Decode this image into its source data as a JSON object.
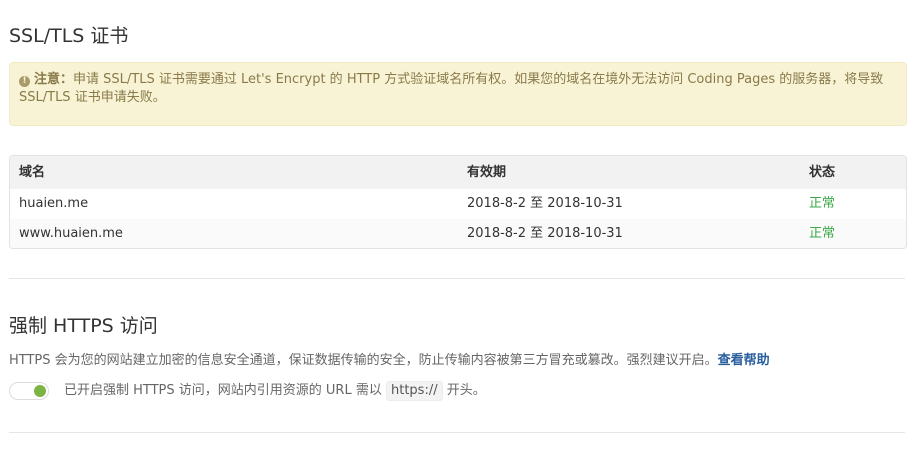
{
  "ssl": {
    "title": "SSL/TLS 证书",
    "warning": {
      "icon": "exclamation-circle-icon",
      "label": "注意：",
      "text": "申请 SSL/TLS 证书需要通过 Let's Encrypt 的 HTTP 方式验证域名所有权。如果您的域名在境外无法访问 Coding Pages 的服务器，将导致 SSL/TLS 证书申请失败。"
    },
    "table": {
      "headers": [
        "域名",
        "有效期",
        "状态"
      ],
      "rows": [
        {
          "domain": "huaien.me",
          "validity": "2018-8-2 至 2018-10-31",
          "status": "正常"
        },
        {
          "domain": "www.huaien.me",
          "validity": "2018-8-2 至 2018-10-31",
          "status": "正常"
        }
      ]
    }
  },
  "https": {
    "title": "强制 HTTPS 访问",
    "description": "HTTPS 会为您的网站建立加密的信息安全通道，保证数据传输的安全，防止传输内容被第三方冒充或篡改。强烈建议开启。",
    "help_link": "查看帮助",
    "toggle_on": true,
    "toggle_text_before": "已开启强制 HTTPS 访问，网站内引用资源的 URL 需以",
    "code": "https://",
    "toggle_text_after": "开头。"
  },
  "colors": {
    "accent_green": "#7cb342",
    "status_ok": "#3aa845",
    "warning_bg": "#f7f3d4",
    "link": "#2a5f9e"
  }
}
